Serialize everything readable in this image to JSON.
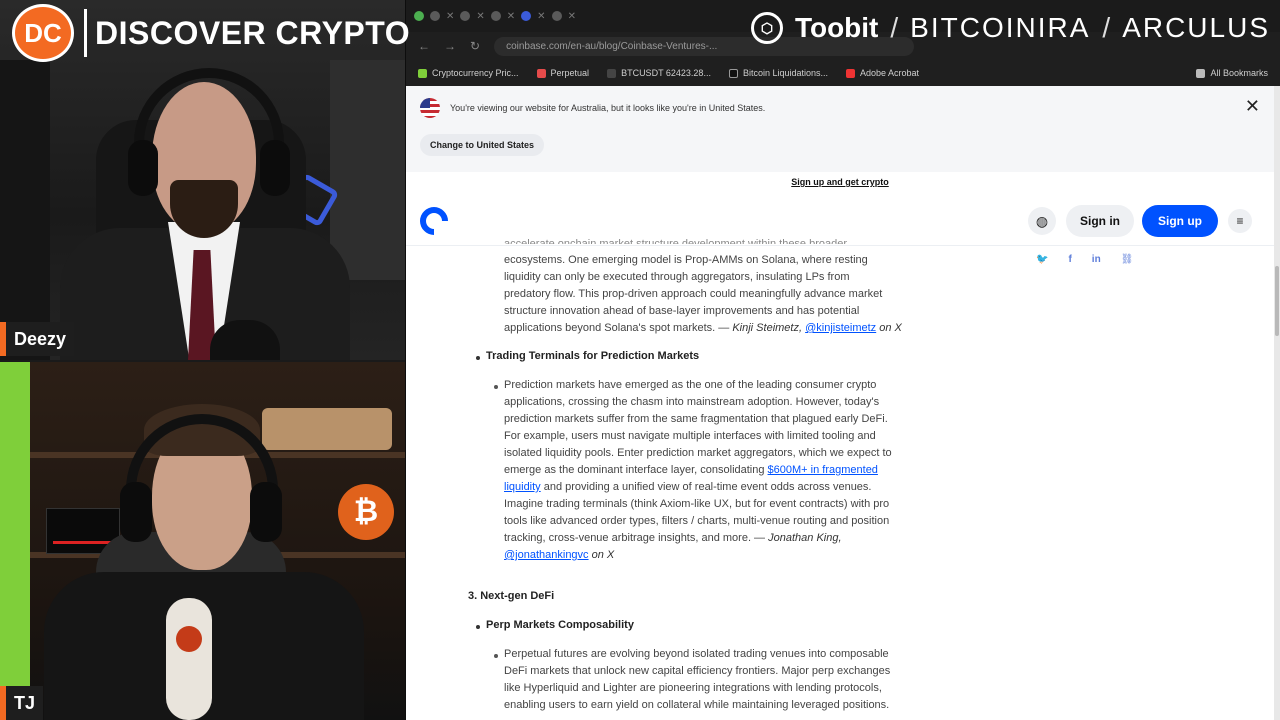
{
  "overlay": {
    "brand_logo": "DC",
    "brand_name": "DISCOVER CRYPTO",
    "sponsors": [
      "Toobit",
      "BITCOINIRA",
      "ARCULUS"
    ],
    "separator": "/",
    "hosts": [
      "Deezy",
      "TJ"
    ],
    "colors": {
      "brand_orange": "#f36a22",
      "coinbase_blue": "#0052ff"
    }
  },
  "browser": {
    "url": "coinbase.com/en-au/blog/Coinbase-Ventures-...",
    "bookmarks": [
      "Cryptocurrency Pric...",
      "Perpetual",
      "BTCUSDT 62423.28...",
      "Bitcoin Liquidations...",
      "Adobe Acrobat"
    ],
    "all_bookmarks": "All Bookmarks"
  },
  "page": {
    "region_notice": "You're viewing our website for Australia, but it looks like you're in United States.",
    "change_region_button": "Change to United States",
    "promo_link": "Sign up and get crypto",
    "signin_label": "Sign in",
    "signup_label": "Sign up",
    "share_icons": [
      "twitter-icon",
      "facebook-icon",
      "linkedin-icon",
      "link-icon"
    ],
    "article": {
      "para1_partial_top": "accelerate onchain market structure development within these broader",
      "para1_l1": "ecosystems. One emerging model is Prop-AMMs on Solana, where resting",
      "para1_l2": "liquidity can only be executed through aggregators, insulating LPs from",
      "para1_l3": "predatory flow. This prop-driven approach could meaningfully advance market",
      "para1_l4": "structure innovation ahead of base-layer improvements and has potential",
      "para1_l5_text": "applications beyond Solana's spot markets. — ",
      "para1_author": "Kinji Steimetz,",
      "para1_handle": "@kinjisteimetz",
      "para1_on": "on X",
      "heading_trading": "Trading Terminals for Prediction Markets",
      "para2_l1": "Prediction markets have emerged as the one of the leading consumer crypto",
      "para2_l2": "applications, crossing the chasm into mainstream adoption. However, today's",
      "para2_l3": "prediction markets suffer from the same fragmentation that plagued early DeFi.",
      "para2_l4": "For example, users must navigate multiple interfaces with limited tooling and",
      "para2_l5": "isolated liquidity pools. Enter prediction market aggregators, which we expect to",
      "para2_l6_text": "emerge as the dominant interface layer, consolidating ",
      "para2_link1": "$600M+ in fragmented",
      "para2_link2": "liquidity",
      "para2_l7_text": " and providing a unified view of real-time event odds across venues.",
      "para2_l8": "Imagine trading terminals (think Axiom-like UX, but for event contracts) with pro",
      "para2_l9": "tools like advanced order types, filters / charts, multi-venue routing and position",
      "para2_l10_text": "tracking, cross-venue arbitrage insights, and more. — ",
      "para2_author": "Jonathan King,",
      "para2_handle": "@jonathankingvc",
      "para2_on": " on X",
      "section3": "3. Next-gen DeFi",
      "heading_perp": "Perp Markets Composability",
      "para3_l1": "Perpetual futures are evolving beyond isolated trading venues into composable",
      "para3_l2": "DeFi markets that unlock new capital efficiency frontiers. Major perp exchanges",
      "para3_l3": "like Hyperliquid and Lighter are pioneering integrations with lending protocols,",
      "para3_l4": "enabling users to earn yield on collateral while maintaining leveraged positions."
    }
  }
}
